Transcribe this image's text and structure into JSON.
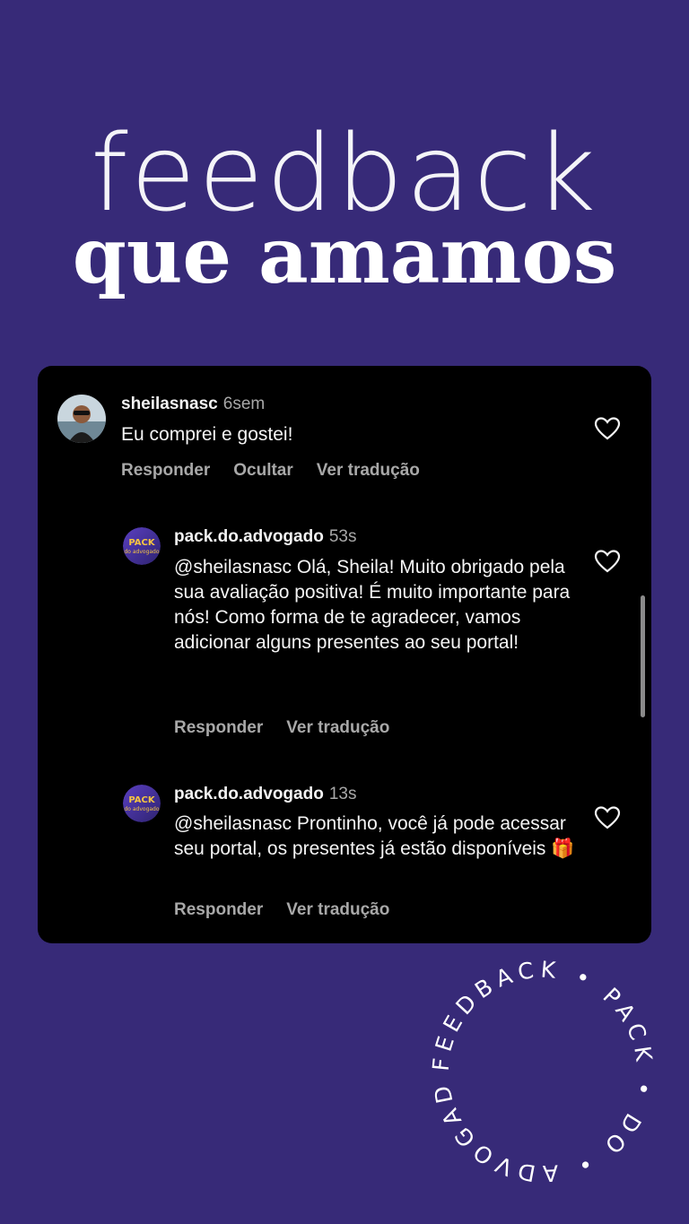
{
  "header": {
    "title_top": "feedback",
    "title_bottom": "que amamos"
  },
  "comments": [
    {
      "username": "sheilasnasc",
      "time": "6sem",
      "text": "Eu comprei e gostei!",
      "actions": [
        "Responder",
        "Ocultar",
        "Ver tradução"
      ]
    },
    {
      "username": "pack.do.advogado",
      "time": "53s",
      "text": "@sheilasnasc Olá, Sheila! Muito obrigado pela sua avaliação positiva! É muito importante para nós! Como forma de te agradecer, vamos adicionar alguns presentes ao seu portal!",
      "actions": [
        "Responder",
        "Ver tradução"
      ]
    },
    {
      "username": "pack.do.advogado",
      "time": "13s",
      "text": "@sheilasnasc Prontinho, você já pode acessar seu portal, os presentes já estão disponíveis 🎁",
      "actions": [
        "Responder",
        "Ver tradução"
      ]
    }
  ],
  "badge": {
    "circular_text": "FEEDBACK • PACK • DO • ADVOGADO •"
  },
  "colors": {
    "background": "#372a78",
    "card": "#000000",
    "muted": "#a8a8a8"
  },
  "icons": [
    "heart-icon",
    "avatar",
    "pack-logo-avatar"
  ]
}
